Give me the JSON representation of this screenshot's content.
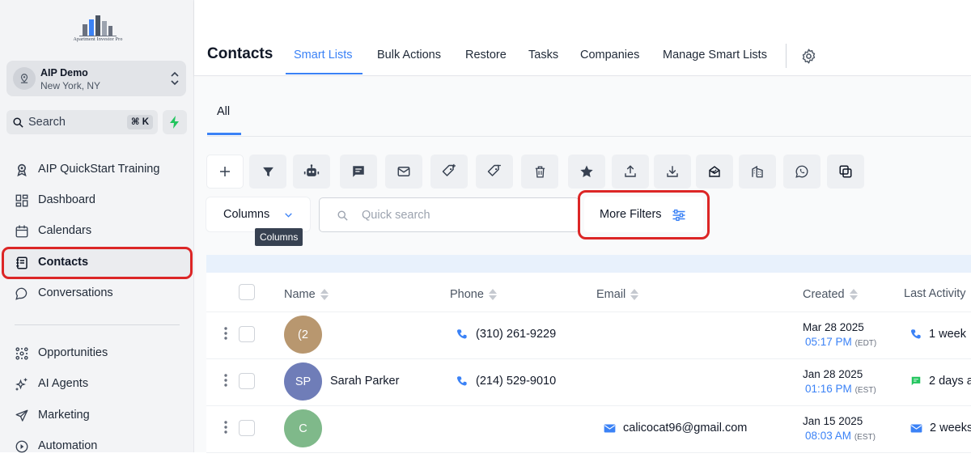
{
  "brand": {
    "logo_text": "Apartment Investor Pro"
  },
  "account": {
    "name": "AIP Demo",
    "location": "New York, NY"
  },
  "sidebar": {
    "search_label": "Search",
    "search_shortcut": "⌘ K",
    "items": [
      {
        "label": "AIP QuickStart Training",
        "icon": "award-icon"
      },
      {
        "label": "Dashboard",
        "icon": "dashboard-icon"
      },
      {
        "label": "Calendars",
        "icon": "calendar-icon"
      },
      {
        "label": "Contacts",
        "icon": "contacts-icon",
        "active": true
      },
      {
        "label": "Conversations",
        "icon": "chat-icon"
      },
      {
        "label": "Opportunities",
        "icon": "opportunities-icon"
      },
      {
        "label": "AI Agents",
        "icon": "sparkle-icon"
      },
      {
        "label": "Marketing",
        "icon": "send-icon"
      },
      {
        "label": "Automation",
        "icon": "automation-icon"
      }
    ]
  },
  "header": {
    "title": "Contacts",
    "tabs": [
      {
        "label": "Smart Lists",
        "active": true
      },
      {
        "label": "Bulk Actions"
      },
      {
        "label": "Restore"
      },
      {
        "label": "Tasks"
      },
      {
        "label": "Companies"
      },
      {
        "label": "Manage Smart Lists"
      }
    ]
  },
  "subtabs": {
    "all": "All"
  },
  "toolbar": {
    "icons": [
      "add-icon",
      "filter-icon",
      "robot-icon",
      "message-icon",
      "email-icon",
      "tag-add-icon",
      "tag-remove-icon",
      "trash-icon",
      "star-icon",
      "upload-icon",
      "download-icon",
      "mailbox-icon",
      "building-icon",
      "whatsapp-icon",
      "merge-icon"
    ]
  },
  "filters": {
    "columns_label": "Columns",
    "columns_tooltip": "Columns",
    "quick_search_placeholder": "Quick search",
    "more_filters_label": "More Filters"
  },
  "table": {
    "headers": {
      "name": "Name",
      "phone": "Phone",
      "email": "Email",
      "created": "Created",
      "last_activity": "Last Activity"
    },
    "rows": [
      {
        "initials": "(2",
        "avatar_color": "#b8976f",
        "name": "",
        "phone": "(310) 261-9229",
        "email": "",
        "created_date": "Mar 28 2025",
        "created_time": "05:17 PM",
        "tz": "(EDT)",
        "activity": "1 week",
        "activity_icon": "phone-icon"
      },
      {
        "initials": "SP",
        "avatar_color": "#6f7db8",
        "name": "Sarah Parker",
        "phone": "(214) 529-9010",
        "email": "",
        "created_date": "Jan 28 2025",
        "created_time": "01:16 PM",
        "tz": "(EST)",
        "activity": "2 days a",
        "activity_icon": "sms-icon"
      },
      {
        "initials": "C",
        "avatar_color": "#7fb98a",
        "name": "",
        "phone": "",
        "email": "calicocat96@gmail.com",
        "created_date": "Jan 15 2025",
        "created_time": "08:03 AM",
        "tz": "(EST)",
        "activity": "2 weeks",
        "activity_icon": "email-icon"
      }
    ]
  },
  "colors": {
    "accent": "#3b82f6",
    "highlight": "#dc2626",
    "sms_green": "#22c55e"
  }
}
